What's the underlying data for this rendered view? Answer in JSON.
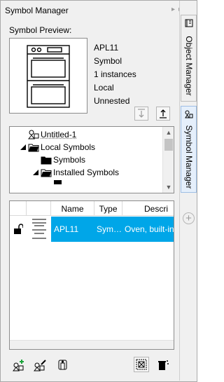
{
  "window": {
    "title": "Symbol Manager",
    "title_buttons": [
      "▸▸",
      "✕"
    ]
  },
  "preview": {
    "label": "Symbol Preview:",
    "name": "APL11",
    "type": "Symbol",
    "instances": "1 instances",
    "location": "Local",
    "nesting": "Unnested"
  },
  "tree": {
    "items": [
      {
        "label": "Untitled-1",
        "level": 0
      },
      {
        "label": "Local Symbols",
        "level": 1
      },
      {
        "label": "Symbols",
        "level": 2
      },
      {
        "label": "Installed Symbols",
        "level": 2
      }
    ]
  },
  "list": {
    "columns": [
      "Name",
      "Type",
      "Descri"
    ],
    "rows": [
      {
        "name": "APL11",
        "type": "Sym…",
        "description": "Oven, built-in,"
      }
    ]
  },
  "side_tabs": [
    {
      "label": "Object Manager"
    },
    {
      "label": "Symbol Manager"
    }
  ],
  "icons": {
    "export": "export-arrow-icon",
    "import": "import-arrow-icon",
    "add_to_library": "add-to-library-icon",
    "edit_symbol": "edit-symbol-icon",
    "delete_symbol": "delete-symbol-icon",
    "select_symbols": "select-symbols-icon",
    "purge": "purge-icon"
  },
  "colors": {
    "selection": "#00a6e8",
    "panel": "#f0f0f0"
  }
}
